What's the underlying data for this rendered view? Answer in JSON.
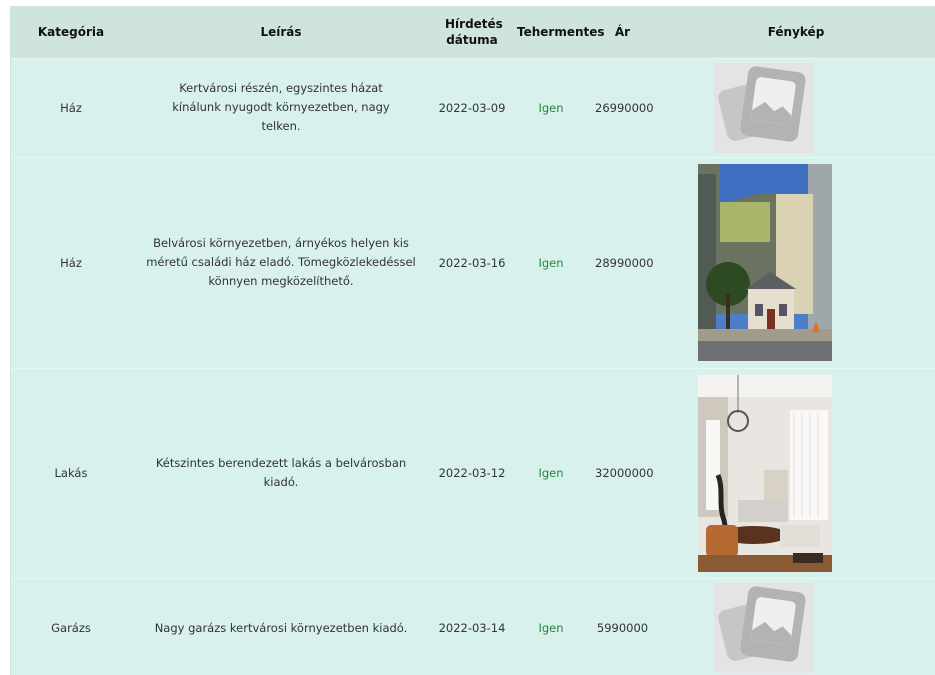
{
  "table": {
    "headers": {
      "category": "Kategória",
      "description": "Leírás",
      "date": "Hírdetés dátuma",
      "unencumbered": "Tehermentes",
      "price": "Ár",
      "photo": "Fénykép"
    },
    "rows": [
      {
        "category": "Ház",
        "description": "Kertvárosi részén, egyszintes házat kínálunk nyugodt környezetben, nagy telken.",
        "date": "2022-03-09",
        "unencumbered": "Igen",
        "price": "26990000",
        "photo": "placeholder-image-icon"
      },
      {
        "category": "Ház",
        "description": "Belvárosi környezetben, árnyékos helyen kis méretű családi ház eladó. Tömegközlekedéssel könnyen megközelíthető.",
        "date": "2022-03-16",
        "unencumbered": "Igen",
        "price": "28990000",
        "photo": "house-photo"
      },
      {
        "category": "Lakás",
        "description": "Kétszintes berendezett lakás a belvárosban kiadó.",
        "date": "2022-03-12",
        "unencumbered": "Igen",
        "price": "32000000",
        "photo": "apartment-photo"
      },
      {
        "category": "Garázs",
        "description": "Nagy garázs kertvárosi környezetben kiadó.",
        "date": "2022-03-14",
        "unencumbered": "Igen",
        "price": "5990000",
        "photo": "placeholder-image-icon"
      }
    ]
  },
  "colors": {
    "header_bg": "#cfe5dc",
    "row_bg": "#d8f1ec",
    "yes_text": "#1e8a3c"
  }
}
